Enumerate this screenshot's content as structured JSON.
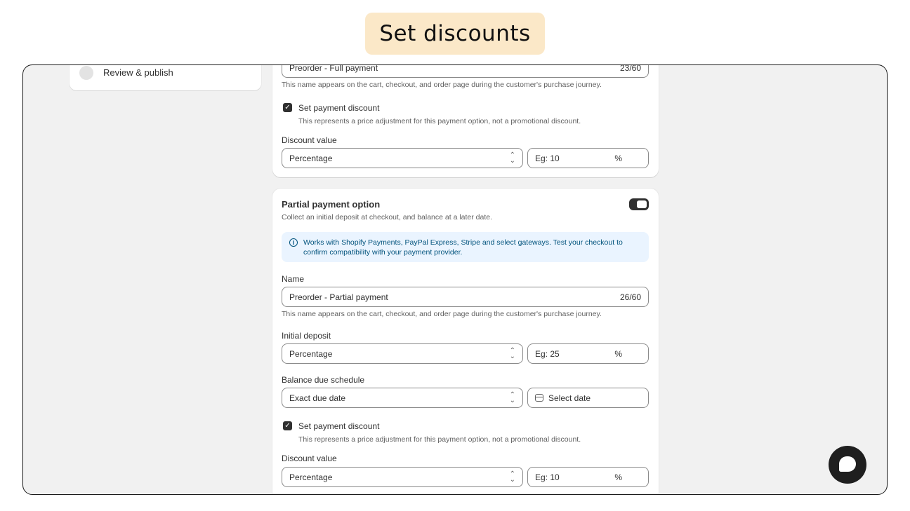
{
  "banner": {
    "title": "Set discounts"
  },
  "sidebar": {
    "step_label": "Review & publish"
  },
  "full_payment": {
    "name_value": "Preorder - Full payment",
    "name_counter": "23/60",
    "name_help": "This name appears on the cart, checkout, and order page during the customer's purchase journey.",
    "discount_checkbox_label": "Set payment discount",
    "discount_checkbox_help": "This represents a price adjustment for this payment option, not a promotional discount.",
    "discount_value_label": "Discount value",
    "discount_type": "Percentage",
    "discount_placeholder": "Eg: 10",
    "discount_unit": "%"
  },
  "partial_payment": {
    "title": "Partial payment option",
    "description": "Collect an initial deposit at checkout, and balance at a later date.",
    "toggle_on": true,
    "info_text": "Works with Shopify Payments, PayPal Express, Stripe and select gateways. Test your checkout to confirm compatibility with your payment provider.",
    "name_label": "Name",
    "name_value": "Preorder - Partial payment",
    "name_counter": "26/60",
    "name_help": "This name appears on the cart, checkout, and order page during the customer's purchase journey.",
    "deposit_label": "Initial deposit",
    "deposit_type": "Percentage",
    "deposit_placeholder": "Eg: 25",
    "deposit_unit": "%",
    "balance_label": "Balance due schedule",
    "balance_type": "Exact due date",
    "date_placeholder": "Select date",
    "discount_checkbox_label": "Set payment discount",
    "discount_checkbox_help": "This represents a price adjustment for this payment option, not a promotional discount.",
    "discount_value_label": "Discount value",
    "discount_type": "Percentage",
    "discount_placeholder": "Eg: 10",
    "discount_unit": "%"
  },
  "icons": {
    "select": "select-arrows-icon",
    "info": "info-icon",
    "calendar": "calendar-icon",
    "checkbox": "checkmark-icon",
    "chat": "chat-icon"
  },
  "colors": {
    "banner_bg": "#fbe8c8",
    "page_bg": "#f1f1f1",
    "info_bg": "#eaf4ff",
    "accent_dark": "#303030"
  }
}
